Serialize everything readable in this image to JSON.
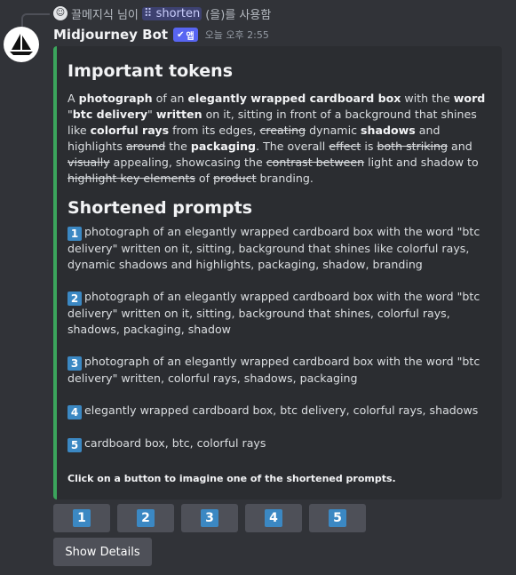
{
  "reply": {
    "user": "끌메지식 님이",
    "command": "shorten",
    "suffix": "(을)를 사용함"
  },
  "message": {
    "username": "Midjourney Bot",
    "badge": "앱",
    "timestamp": "오늘 오후 2:55"
  },
  "embed": {
    "heading_tokens": "Important tokens",
    "heading_prompts": "Shortened prompts",
    "footer": "Click on a button to imagine one of the shortened prompts.",
    "accent_color": "#3ba55c",
    "tokens": [
      {
        "t": "A ",
        "s": "n"
      },
      {
        "t": "photograph",
        "s": "b"
      },
      {
        "t": " of an ",
        "s": "n"
      },
      {
        "t": "elegantly wrapped cardboard box",
        "s": "b"
      },
      {
        "t": " with the ",
        "s": "n"
      },
      {
        "t": "word",
        "s": "b"
      },
      {
        "t": " \"",
        "s": "n"
      },
      {
        "t": "btc delivery",
        "s": "b"
      },
      {
        "t": "\" ",
        "s": "n"
      },
      {
        "t": "written",
        "s": "b"
      },
      {
        "t": " on it, sitting in front of a background that shines like ",
        "s": "n"
      },
      {
        "t": "colorful rays",
        "s": "b"
      },
      {
        "t": " from its edges, ",
        "s": "n"
      },
      {
        "t": "creating",
        "s": "s"
      },
      {
        "t": " dynamic ",
        "s": "n"
      },
      {
        "t": "shadows",
        "s": "b"
      },
      {
        "t": " and highlights ",
        "s": "n"
      },
      {
        "t": "around",
        "s": "s"
      },
      {
        "t": " the ",
        "s": "n"
      },
      {
        "t": "packaging",
        "s": "b"
      },
      {
        "t": ". The overall ",
        "s": "n"
      },
      {
        "t": "effect",
        "s": "s"
      },
      {
        "t": " is ",
        "s": "n"
      },
      {
        "t": "both striking",
        "s": "s"
      },
      {
        "t": " and ",
        "s": "n"
      },
      {
        "t": "visually",
        "s": "s"
      },
      {
        "t": " appealing, showcasing the ",
        "s": "n"
      },
      {
        "t": "contrast between",
        "s": "s"
      },
      {
        "t": " light and shadow to ",
        "s": "n"
      },
      {
        "t": "highlight key elements",
        "s": "s"
      },
      {
        "t": " of ",
        "s": "n"
      },
      {
        "t": "product",
        "s": "s"
      },
      {
        "t": " branding.",
        "s": "n"
      }
    ],
    "prompts": [
      {
        "num": "1",
        "text": "photograph of an elegantly wrapped cardboard box with the word \"btc delivery\" written on it, sitting, background that shines like colorful rays, dynamic shadows and highlights, packaging, shadow, branding"
      },
      {
        "num": "2",
        "text": "photograph of an elegantly wrapped cardboard box with the word \"btc delivery\" written on it, sitting, background that shines, colorful rays, shadows, packaging, shadow"
      },
      {
        "num": "3",
        "text": "photograph of an elegantly wrapped cardboard box with the word \"btc delivery\" written, colorful rays, shadows, packaging"
      },
      {
        "num": "4",
        "text": "elegantly wrapped cardboard box, btc delivery, colorful rays, shadows"
      },
      {
        "num": "5",
        "text": "cardboard box, btc, colorful rays"
      }
    ]
  },
  "buttons": [
    "1",
    "2",
    "3",
    "4",
    "5"
  ],
  "details_button": "Show Details"
}
